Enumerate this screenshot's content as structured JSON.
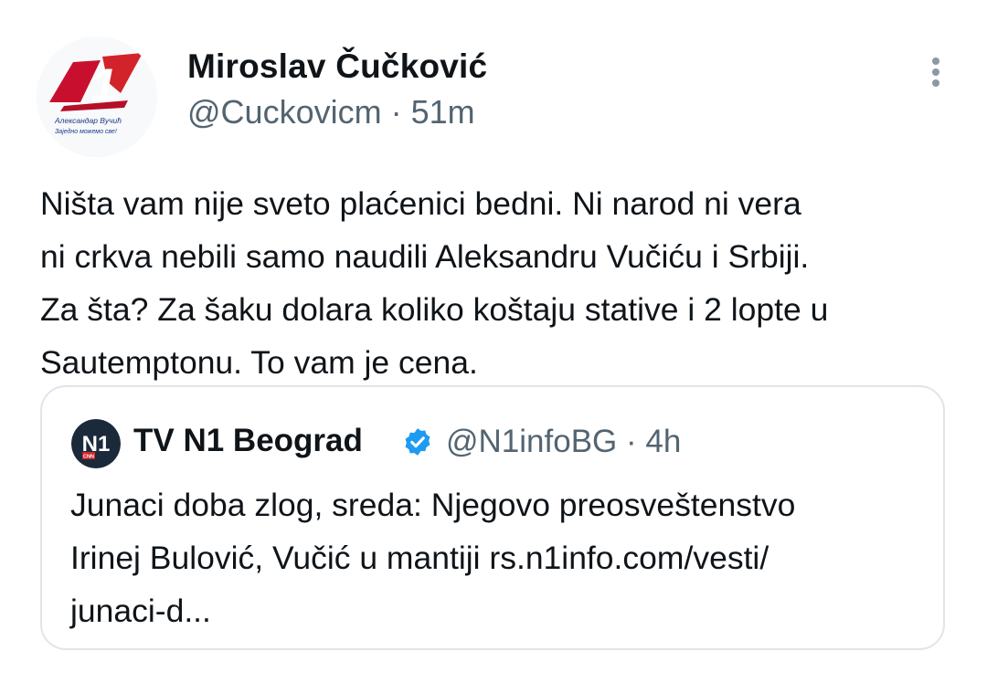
{
  "tweet": {
    "author_name": "Miroslav Čučković",
    "author_handle": "@Cuckovicm",
    "separator": "·",
    "time": "51m",
    "avatar_logo_number": "1",
    "avatar_text_line1": "Александар Вучић",
    "avatar_text_line2": "Заједно можемо све!",
    "text_lines": [
      "Ništa vam nije sveto plaćenici bedni. Ni narod ni vera",
      "ni crkva nebili samo naudili Aleksandru Vučiću i Srbiji.",
      "Za šta? Za šaku dolara koliko koštaju stative i 2 lopte u",
      "Sautemptonu. To vam je cena."
    ]
  },
  "quoted_tweet": {
    "author_name": "TV N1 Beograd",
    "verified": true,
    "author_handle": "@N1infoBG",
    "separator": "·",
    "time": "4h",
    "avatar_logo_text": "N1",
    "avatar_small_text": "CNN",
    "text_lines": [
      "Junaci doba zlog, sreda: Njegovo preosveštenstvo",
      "Irinej Bulović, Vučić u mantiji rs.n1info.com/vesti/",
      "junaci-d..."
    ]
  },
  "icons": {
    "more": "more-vertical-icon",
    "verified": "verified-badge-icon"
  },
  "colors": {
    "text": "#0f1419",
    "secondary": "#536471",
    "verified": "#1d9bf0",
    "logo_red": "#d2232a",
    "border": "#dfe5ea"
  }
}
